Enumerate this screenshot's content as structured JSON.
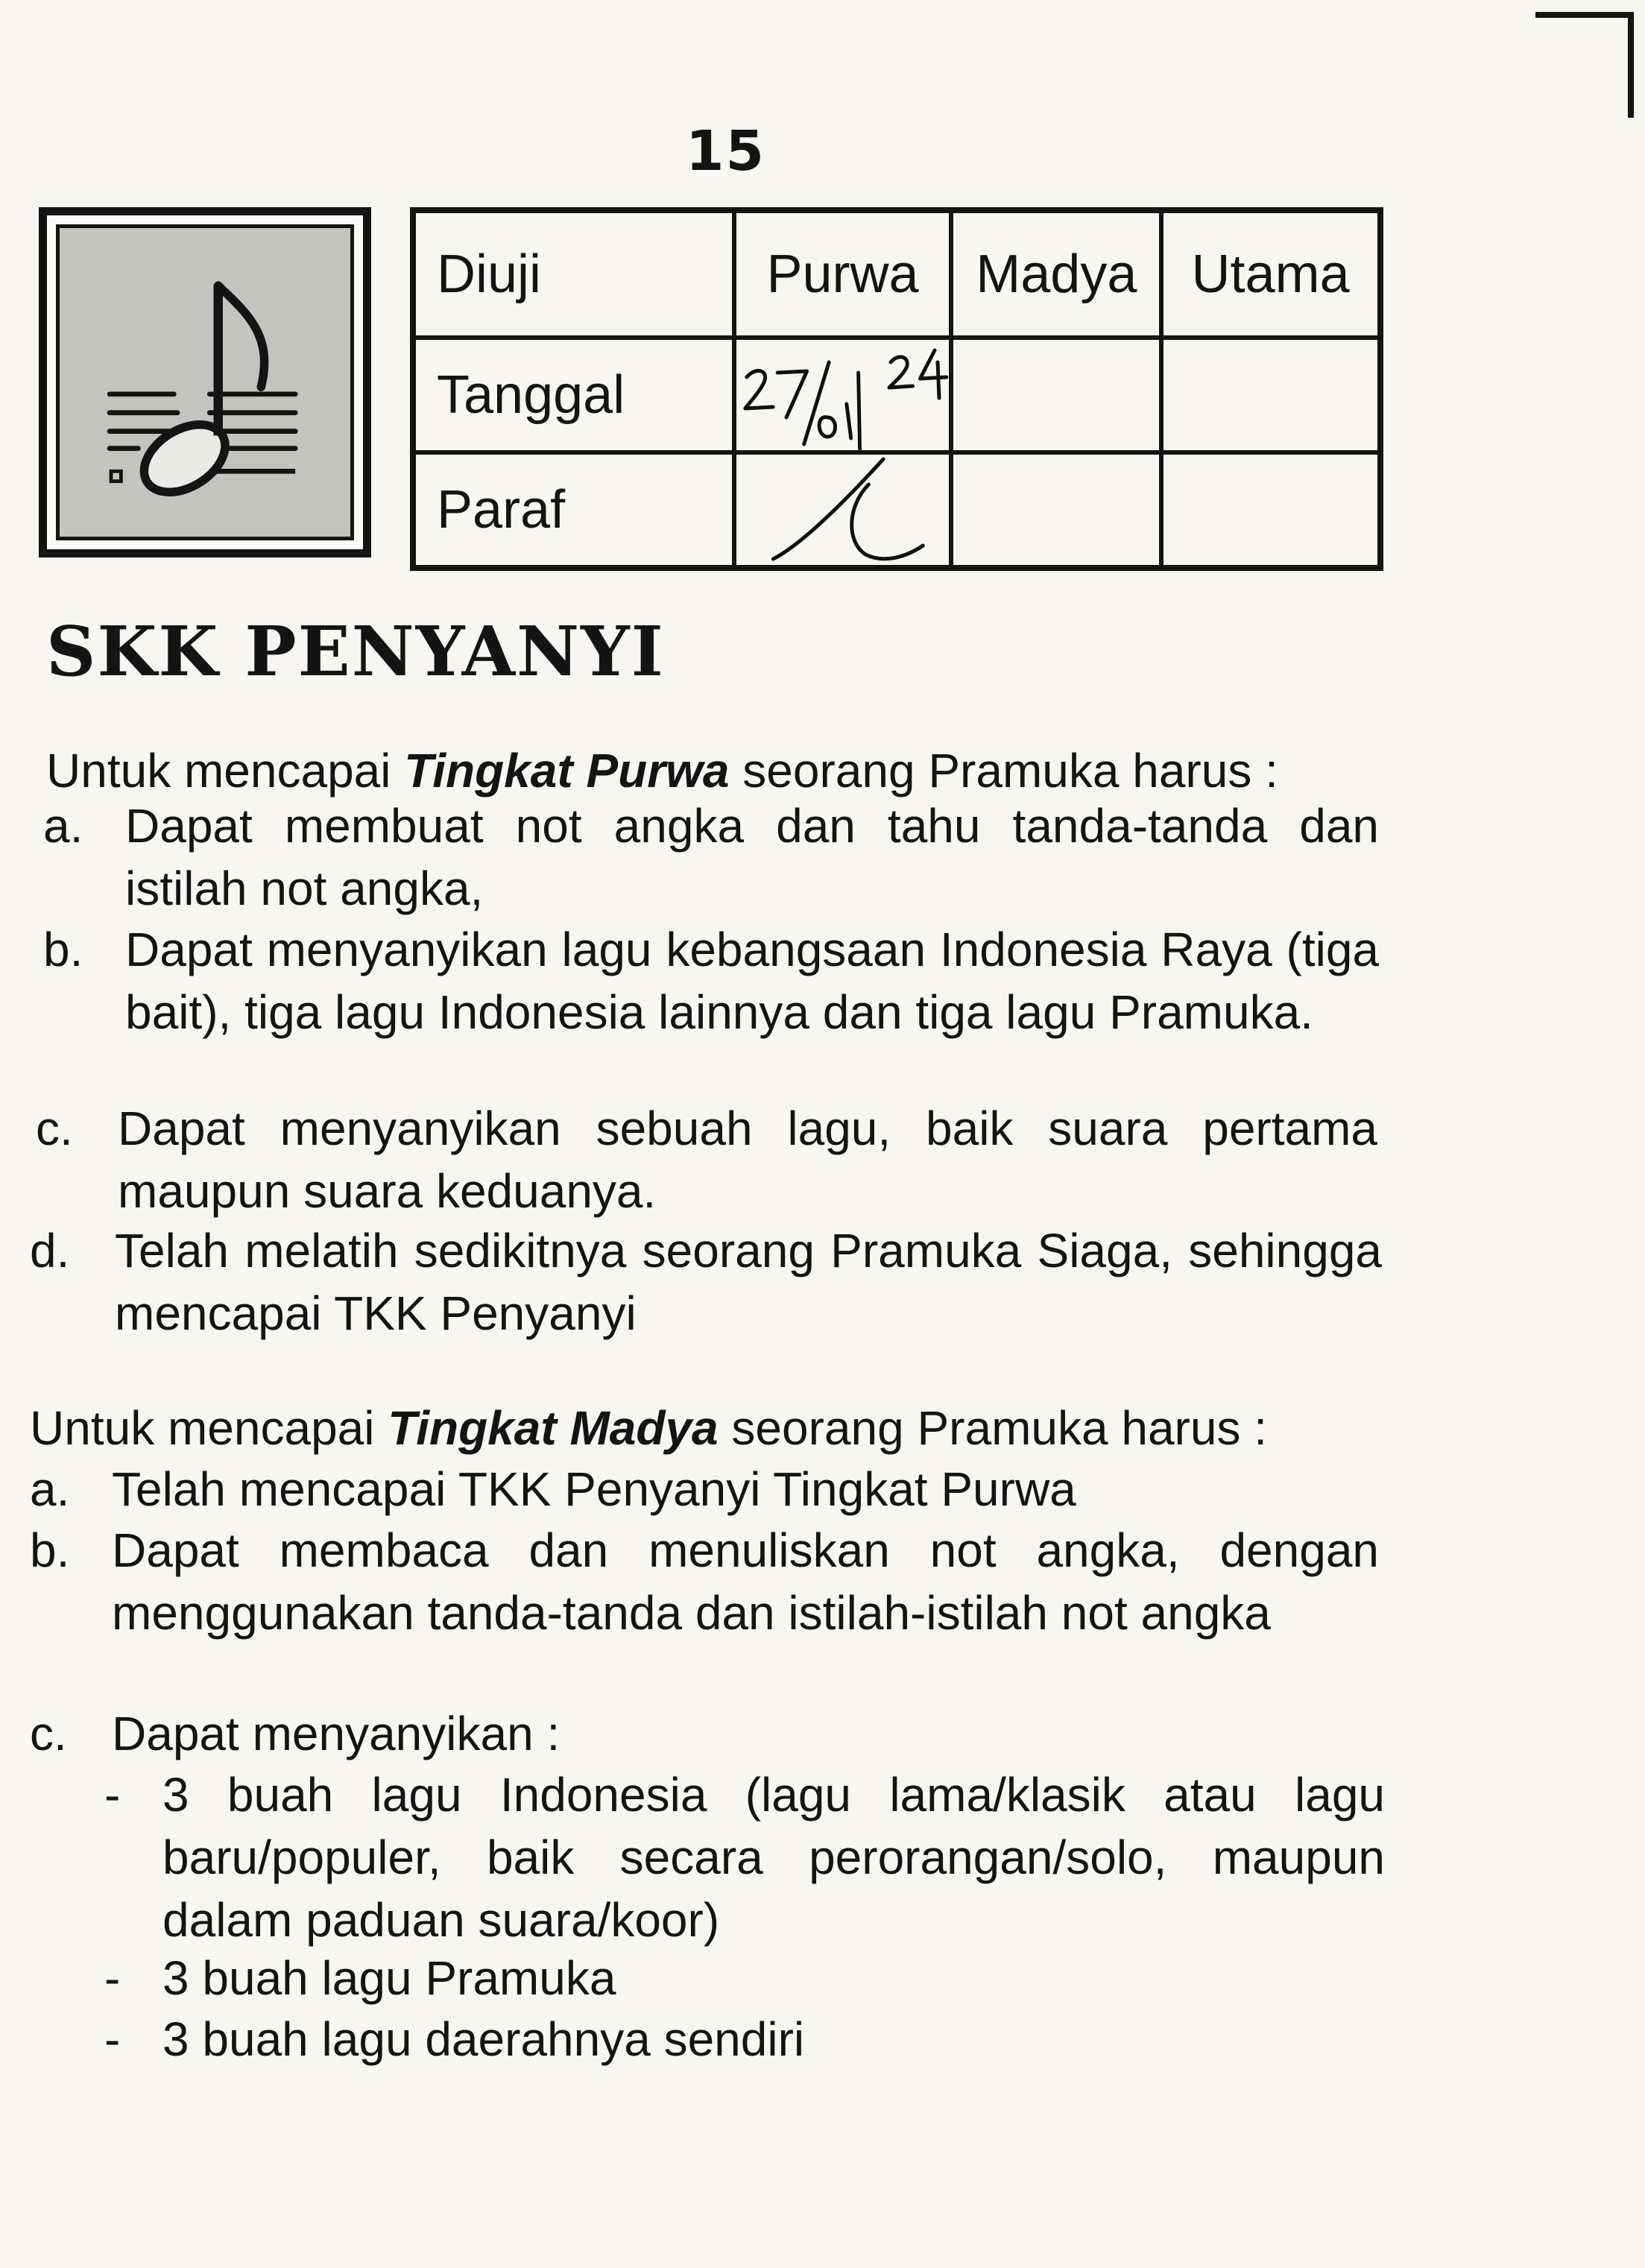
{
  "page": {
    "number": "15"
  },
  "badge": {
    "icon": "music-note-icon"
  },
  "test_table": {
    "headers": [
      "Diuji",
      "Purwa",
      "Madya",
      "Utama"
    ],
    "rows": [
      {
        "label": "Tanggal",
        "purwa": "27/01/24",
        "madya": "",
        "utama": ""
      },
      {
        "label": "Paraf",
        "purwa": "",
        "madya": "",
        "utama": ""
      }
    ]
  },
  "title": "SKK PENYANYI",
  "purwa": {
    "intro_before": "Untuk mencapai ",
    "intro_level": "Tingkat Purwa",
    "intro_after": " seorang Pramuka harus :",
    "items": [
      {
        "letter": "a.",
        "text": "Dapat membuat not angka dan tahu tanda-tanda dan istilah not angka,"
      },
      {
        "letter": "b.",
        "text": "Dapat menyanyikan lagu kebangsaan Indonesia Raya (tiga bait), tiga lagu Indonesia lainnya dan tiga lagu Pramuka."
      },
      {
        "letter": "c.",
        "text": "Dapat menyanyikan sebuah lagu, baik suara pertama maupun suara keduanya."
      },
      {
        "letter": "d.",
        "text": "Telah melatih sedikitnya seorang Pramuka Siaga, sehingga mencapai TKK Penyanyi"
      }
    ]
  },
  "madya": {
    "intro_before": "Untuk mencapai ",
    "intro_level": "Tingkat Madya",
    "intro_after": " seorang Pramuka harus :",
    "items": [
      {
        "letter": "a.",
        "text": "Telah mencapai TKK Penyanyi Tingkat Purwa"
      },
      {
        "letter": "b.",
        "text": "Dapat membaca dan menuliskan not angka, dengan menggunakan tanda-tanda dan istilah-istilah not angka"
      },
      {
        "letter": "c.",
        "text": "Dapat menyanyikan :"
      }
    ],
    "subitems": [
      {
        "dash": "-",
        "text": "3 buah lagu Indonesia (lagu lama/klasik atau lagu baru/populer, baik secara perorangan/solo, maupun dalam paduan suara/koor)"
      },
      {
        "dash": "-",
        "text": "3 buah lagu Pramuka"
      },
      {
        "dash": "-",
        "text": "3 buah lagu daerahnya sendiri"
      }
    ]
  }
}
